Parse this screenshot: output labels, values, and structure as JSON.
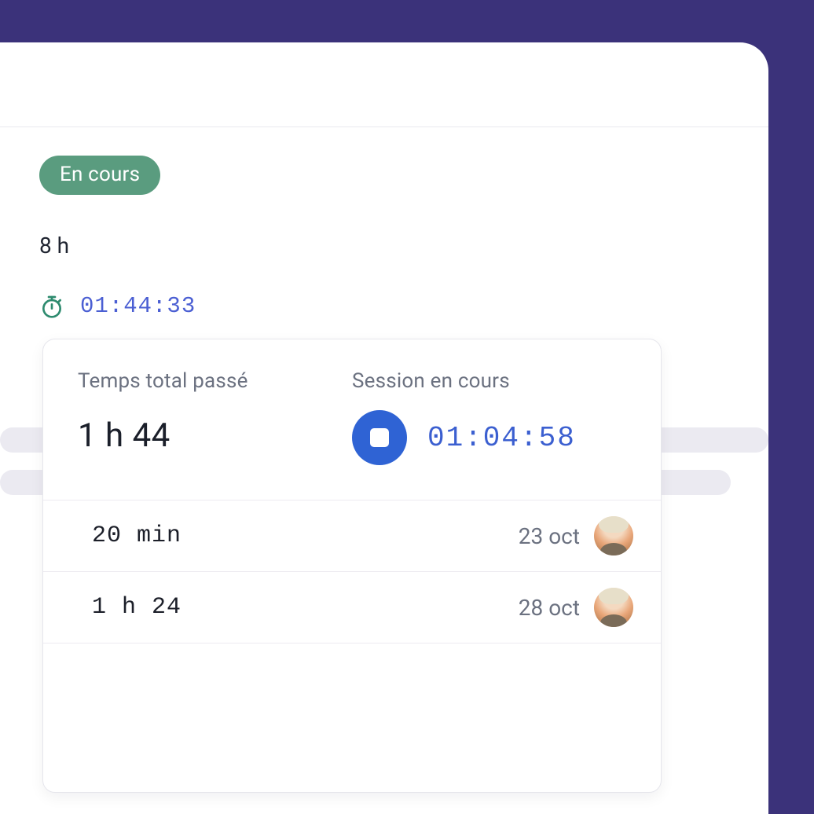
{
  "status": {
    "label": "En cours"
  },
  "planned_duration": "8 h",
  "timer": {
    "value": "01:44:33"
  },
  "popover": {
    "total_label": "Temps total passé",
    "total_value": "1 h 44",
    "session_label": "Session en cours",
    "session_value": "01:04:58",
    "entries": [
      {
        "duration": "20 min",
        "date": "23 oct"
      },
      {
        "duration": "1 h 24",
        "date": "28 oct"
      }
    ]
  }
}
